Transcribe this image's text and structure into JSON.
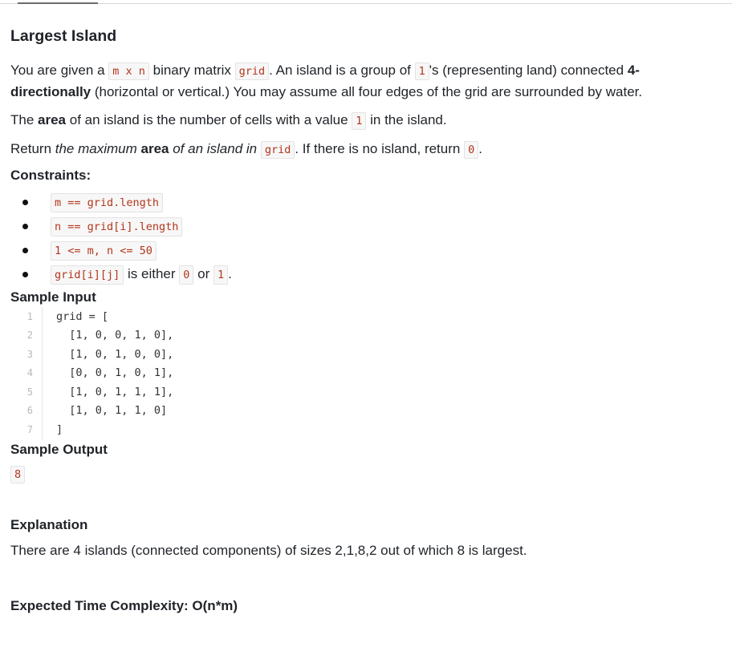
{
  "problem": {
    "title": "Largest Island",
    "desc": {
      "t1": "You are given a ",
      "c1": "m x n",
      "t2": " binary matrix ",
      "c2": "grid",
      "t3": ". An island is a group of ",
      "c3": "1",
      "t4": "'s (representing land) connected ",
      "b1": "4-directionally",
      "t5": " (horizontal or vertical.) You may assume all four edges of the grid are surrounded by water."
    },
    "area": {
      "t1": "The ",
      "b1": "area",
      "t2": " of an island is the number of cells with a value ",
      "c1": "1",
      "t3": " in the island."
    },
    "ret": {
      "t1": "Return ",
      "i1": "the maximum ",
      "b1": "area",
      "i2": " of an island in ",
      "c1": "grid",
      "t2": ". If there is no island, return ",
      "c2": "0",
      "t3": "."
    }
  },
  "constraints": {
    "title": "Constraints:",
    "items": {
      "c0": "m == grid.length",
      "c1": "n == grid[i].length",
      "c2": "1 <= m, n <= 50",
      "c3a": "grid[i][j]",
      "c3t1": " is either ",
      "c3b": "0",
      "c3t2": " or ",
      "c3c": "1",
      "c3t3": "."
    }
  },
  "sample_input": {
    "title": "Sample Input",
    "lines": [
      {
        "n": "1",
        "text": "grid = ["
      },
      {
        "n": "2",
        "text": "  [1, 0, 0, 1, 0],"
      },
      {
        "n": "3",
        "text": "  [1, 0, 1, 0, 0],"
      },
      {
        "n": "4",
        "text": "  [0, 0, 1, 0, 1],"
      },
      {
        "n": "5",
        "text": "  [1, 0, 1, 1, 1],"
      },
      {
        "n": "6",
        "text": "  [1, 0, 1, 1, 0]"
      },
      {
        "n": "7",
        "text": "]"
      }
    ]
  },
  "sample_output": {
    "title": "Sample Output",
    "value": "8"
  },
  "explanation": {
    "title": "Explanation",
    "text": "There are 4 islands (connected components) of sizes 2,1,8,2 out of which 8 is largest."
  },
  "complexity": {
    "text": "Expected Time Complexity: O(n*m)"
  }
}
